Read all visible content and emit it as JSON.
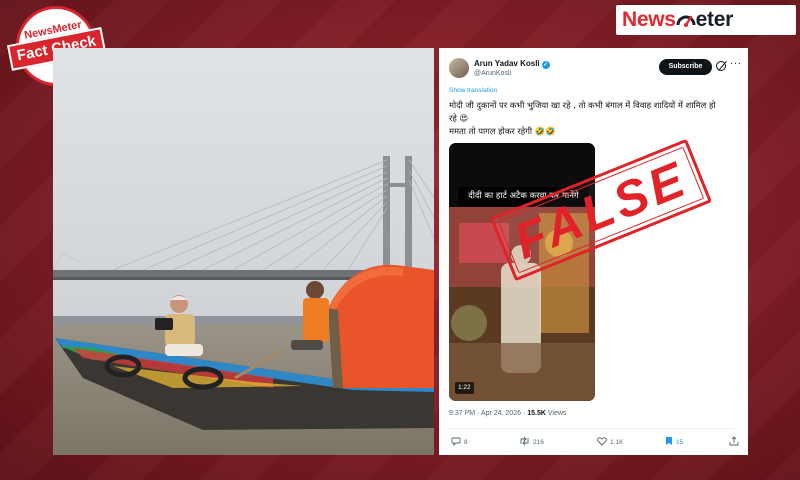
{
  "brand": {
    "news": "News",
    "meter": "eter",
    "logo_alt": "NewsMeter"
  },
  "fact_check": {
    "brand": "NewsMeter",
    "label": "Fact Check"
  },
  "tweet": {
    "name": "Arun Yadav Kosli",
    "handle": "@ArunKosli",
    "subscribe_label": "Subscribe",
    "show_translation": "Show translation",
    "text_lines": [
      "मोदी जी दुकानों पर कभी भुजिया खा रहे , तो कभी बंगाल में विवाह शादियों में शामिल हो",
      "रहे 😍",
      "ममता तो पागल होकर रहेगी 🤣🤣"
    ],
    "video_caption": "दीदी का हार्ट अटैक करवा कर मानेंगे",
    "duration": "1:22",
    "time": "9:37 PM · Apr 24, 2026 · ",
    "views_count": "15.5K",
    "views_label": " Views",
    "replies": "8",
    "reposts": "216",
    "likes": "1.1K",
    "bookmarks": "15"
  },
  "stamp": {
    "text": "FALSE"
  },
  "colors": {
    "background": "#7e1c24",
    "brand_red": "#e02a2f",
    "stamp_red": "#e12228",
    "link_blue": "#1d9bf0"
  },
  "icons": [
    "search-icon",
    "verified-badge-icon",
    "grok-icon",
    "more-icon",
    "reply-icon",
    "repost-icon",
    "like-icon",
    "bookmark-icon",
    "share-icon",
    "speedometer-icon"
  ]
}
